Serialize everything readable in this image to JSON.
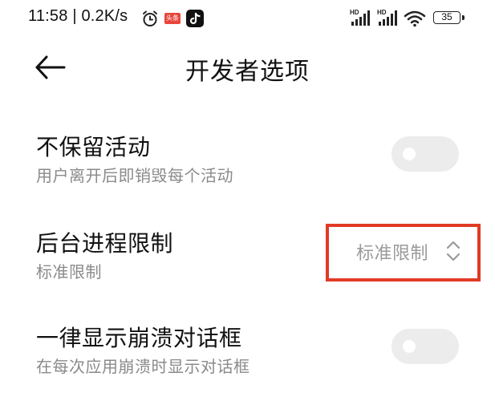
{
  "status_bar": {
    "time_speed": "11:58 | 0.2K/s",
    "news_badge": "头条",
    "signal_1_label": "HD",
    "signal_2_label": "HD",
    "battery_level": "35",
    "icons": [
      "alarm-icon",
      "news-app-icon",
      "tiktok-icon",
      "signal-icon",
      "signal-icon",
      "wifi-icon",
      "battery-icon"
    ]
  },
  "header": {
    "title": "开发者选项",
    "back_icon": "arrow-left-icon"
  },
  "settings": [
    {
      "title": "不保留活动",
      "subtitle": "用户离开后即销毁每个活动",
      "control": "toggle",
      "enabled": false
    },
    {
      "title": "后台进程限制",
      "subtitle": "标准限制",
      "control": "dropdown",
      "value": "标准限制",
      "highlight_color": "#e23a25"
    },
    {
      "title": "一律显示崩溃对话框",
      "subtitle": "在每次应用崩溃时显示对话框",
      "control": "toggle",
      "enabled": false
    }
  ]
}
